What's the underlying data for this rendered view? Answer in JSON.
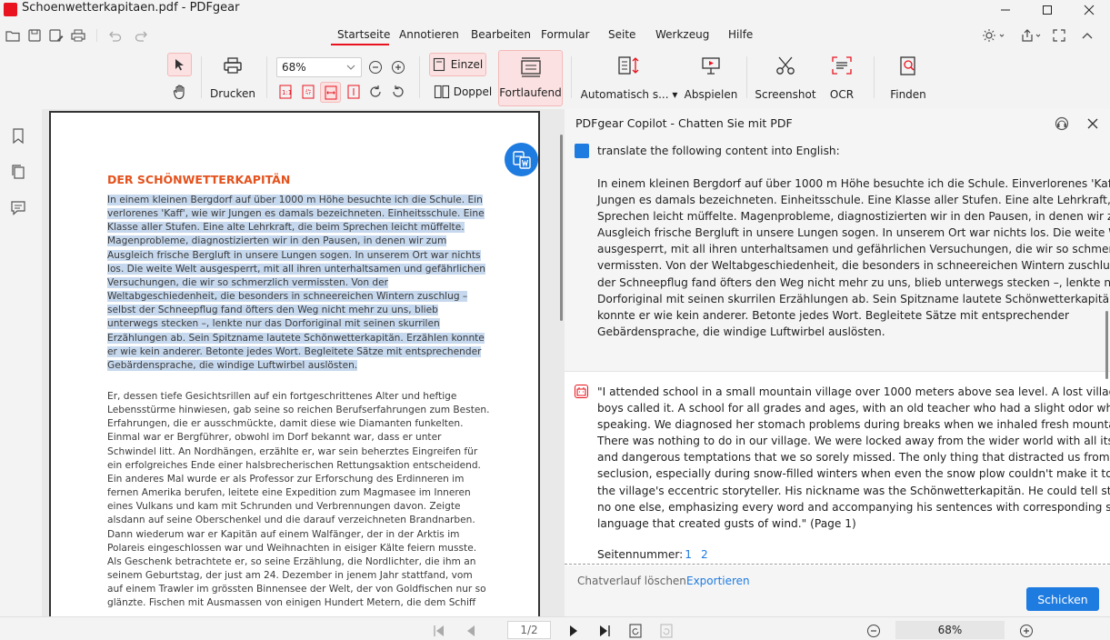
{
  "window": {
    "title": "Schoenwetterkapitaen.pdf - PDFgear"
  },
  "menu": {
    "items": [
      "Startseite",
      "Annotieren",
      "Bearbeiten",
      "Formular",
      "Seite",
      "Werkzeug",
      "Hilfe"
    ],
    "active": "Startseite"
  },
  "toolbar": {
    "print_label": "Drucken",
    "zoom_value": "68%",
    "single_label": "Einzel",
    "double_label": "Doppel",
    "continuous_label": "Fortlaufend",
    "auto_scroll_label": "Automatisch s...",
    "play_label": "Abspielen",
    "screenshot_label": "Screenshot",
    "ocr_label": "OCR",
    "find_label": "Finden"
  },
  "document": {
    "heading": "DER SCHÖNWETTERKAPITÄN",
    "para1": [
      "In einem kleinen Bergdorf auf über 1000 m Höhe besuchte ich die Schule. Ein",
      "verlorenes 'Kaff', wie wir Jungen es damals bezeichneten. Einheitsschule. Eine",
      "Klasse aller Stufen. Eine alte Lehrkraft, die beim Sprechen leicht müffelte.",
      "Magenprobleme, diagnostizierten wir in den Pausen, in denen wir zum",
      "Ausgleich frische Bergluft in unsere Lungen sogen. In unserem Ort war nichts",
      "los. Die weite Welt ausgesperrt, mit all ihren unterhaltsamen und gefährlichen",
      "Versuchungen, die wir so schmerzlich vermissten. Von der",
      "Weltabgeschiedenheit, die besonders in schneereichen Wintern zuschlug –",
      "selbst der Schneepflug fand öfters den Weg nicht mehr zu uns, blieb",
      "unterwegs stecken –, lenkte nur das Dorforiginal mit seinen skurrilen",
      "Erzählungen ab. Sein Spitzname lautete Schönwetterkapitän. Erzählen konnte",
      "er wie kein anderer. Betonte jedes Wort. Begleitete Sätze mit entsprechender",
      "Gebärdensprache, die windige Luftwirbel auslösten."
    ],
    "para2": [
      "Er, dessen tiefe Gesichtsrillen auf ein fortgeschrittenes Alter und heftige",
      "Lebensstürme hinwiesen, gab seine so reichen Berufserfahrungen zum Besten.",
      "Erfahrungen, die er ausschmückte, damit diese wie Diamanten funkelten.",
      "Einmal war er Bergführer, obwohl im Dorf bekannt war, dass er unter",
      "Schwindel litt. An Nordhängen, erzählte er, war sein beherztes Eingreifen für",
      "ein erfolgreiches Ende einer halsbrecherischen Rettungsaktion entscheidend.",
      "Ein anderes Mal wurde er als Professor zur Erforschung des Erdinneren im",
      "fernen Amerika berufen, leitete eine Expedition zum Magmasee im Inneren",
      "eines Vulkans und kam mit Schrunden und Verbrennungen davon. Zeigte",
      "alsdann auf seine Oberschenkel und die darauf verzeichneten Brandnarben.",
      "Dann wiederum war er Kapitän auf einem Walfänger, der in der Arktis im",
      "Polareis eingeschlossen war und Weihnachten in eisiger Kälte feiern musste.",
      "Als Geschenk betrachtete er, so seine Erzählung, die Nordlichter, die ihm an",
      "seinem Geburtstag, der just am 24. Dezember in jenem Jahr stattfand, vom",
      "auf einem Trawler im grössten Binnensee der Welt, der von Goldfischen nur so",
      "glänzte. Fischen mit Ausmassen von einigen Hundert Metern, die dem Schiff"
    ]
  },
  "copilot": {
    "title": "PDFgear Copilot - Chatten Sie mit PDF",
    "user_prompt": "translate the following content into English:",
    "user_body": [
      "In einem kleinen Bergdorf auf über 1000 m Höhe besuchte ich die Schule. Einverlorenes 'Kaff', wie wir",
      "Jungen es damals bezeichneten. Einheitsschule. Eine Klasse aller Stufen. Eine alte Lehrkraft, die beim",
      "Sprechen leicht müffelte. Magenprobleme, diagnostizierten wir in den Pausen, in denen wir zum",
      "Ausgleich frische Bergluft in unsere Lungen sogen. In unserem Ort war nichts los. Die weite Welt",
      "ausgesperrt, mit all ihren unterhaltsamen und gefährlichen Versuchungen, die wir so schmerzlich",
      "vermissten. Von der Weltabgeschiedenheit, die besonders in schneereichen Wintern zuschlug – selbst",
      "der Schneepflug fand öfters den Weg nicht mehr zu uns, blieb unterwegs stecken –, lenkte nur das",
      "Dorforiginal mit seinen skurrilen Erzählungen ab. Sein Spitzname lautete Schönwetterkapitän. Erzählen",
      "konnte er wie kein anderer. Betonte jedes Wort. Begleitete Sätze mit entsprechender",
      "Gebärdensprache, die windige Luftwirbel auslösten."
    ],
    "bot_body": [
      "\"I attended school in a small mountain village over 1000 meters above sea level. A lost village, as we",
      "boys called it. A school for all grades and ages, with an old teacher who had a slight odor when",
      "speaking. We diagnosed her stomach problems during breaks when we inhaled fresh mountain air.",
      "There was nothing to do in our village. We were locked away from the wider world with all its amusing",
      "and dangerous temptations that we so sorely missed. The only thing that distracted us from the",
      "seclusion, especially during snow-filled winters when even the snow plow couldn't make it to us, was",
      "the village's eccentric storyteller. His nickname was the Schönwetterkapitän. He could tell stories like",
      "no one else, emphasizing every word and accompanying his sentences with corresponding sign",
      "language that created gusts of wind.\" (Page 1)"
    ],
    "page_numbers_label": "Seitennummer:",
    "page_links": [
      "1",
      "2"
    ],
    "clear_history": "Chatverlauf löschen",
    "export": "Exportieren",
    "send": "Schicken"
  },
  "statusbar": {
    "page": "1/2",
    "zoom": "68%"
  }
}
